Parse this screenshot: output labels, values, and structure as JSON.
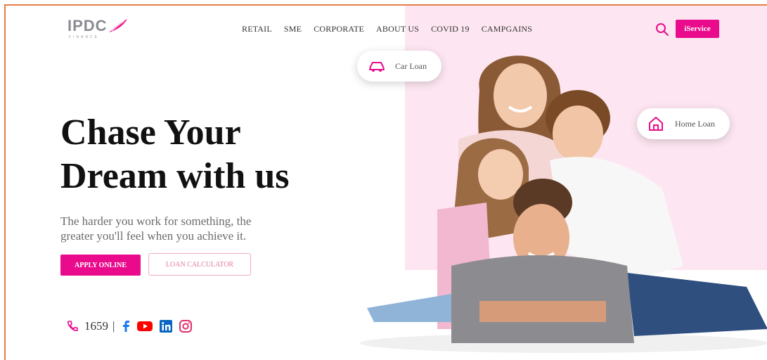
{
  "header": {
    "logo_text": "IPDC",
    "logo_subtext": "FINANCE",
    "nav": [
      "RETAIL",
      "SME",
      "CORPORATE",
      "ABOUT US",
      "COVID 19",
      "CAMPGAINS"
    ],
    "service_button": "iService"
  },
  "hero": {
    "title_line1": "Chase Your",
    "title_line2": "Dream with us",
    "subtitle_line1": "The harder you work for something, the",
    "subtitle_line2": "greater you'll feel when you achieve it.",
    "apply_button": "APPLY ONLINE",
    "calculator_button": "LOAN CALCULATOR"
  },
  "contact": {
    "phone": "1659",
    "separator": "|",
    "social_icons": [
      "facebook-icon",
      "youtube-icon",
      "linkedin-icon",
      "instagram-icon"
    ]
  },
  "badges": {
    "car_loan": "Car Loan",
    "home_loan": "Home Loan"
  },
  "colors": {
    "brand_pink": "#ea0b8c",
    "panel_pink": "#fde6f1",
    "frame_orange": "#e87d48",
    "facebook": "#1877f2",
    "youtube": "#ff0000",
    "linkedin": "#0a66c2",
    "instagram": "#e1306c"
  }
}
